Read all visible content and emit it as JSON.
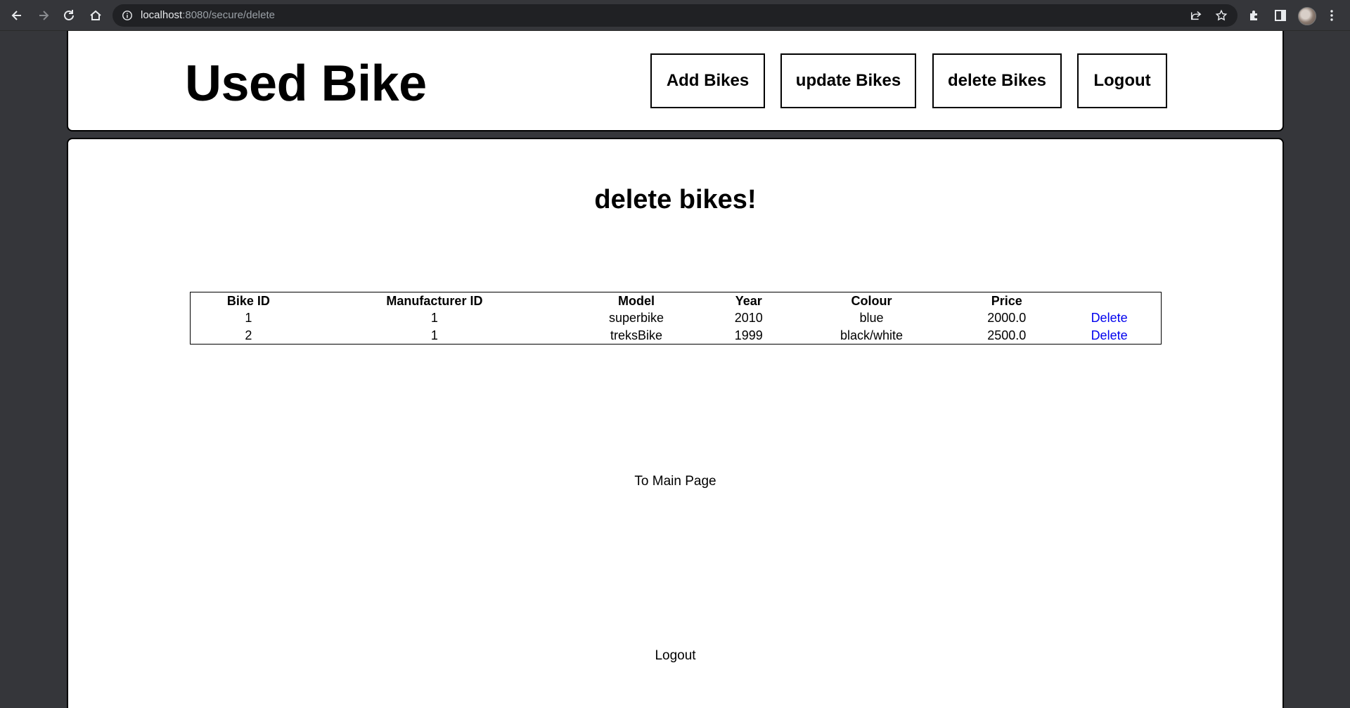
{
  "browser": {
    "url_host": "localhost",
    "url_rest": ":8080/secure/delete"
  },
  "header": {
    "title": "Used Bike",
    "nav": {
      "add_label": "Add Bikes",
      "update_label": "update Bikes",
      "delete_label": "delete Bikes",
      "logout_label": "Logout"
    }
  },
  "main": {
    "heading": "delete bikes!",
    "table": {
      "headers": [
        "Bike ID",
        "Manufacturer ID",
        "Model",
        "Year",
        "Colour",
        "Price",
        ""
      ],
      "rows": [
        {
          "bike_id": "1",
          "manufacturer_id": "1",
          "model": "superbike",
          "year": "2010",
          "colour": "blue",
          "price": "2000.0",
          "action": "Delete"
        },
        {
          "bike_id": "2",
          "manufacturer_id": "1",
          "model": "treksBike",
          "year": "1999",
          "colour": "black/white",
          "price": "2500.0",
          "action": "Delete"
        }
      ]
    },
    "to_main_label": "To Main Page",
    "logout_label": "Logout"
  },
  "colors": {
    "chrome_bg": "#35363a",
    "omnibox_bg": "#202124",
    "link": "#0000ee"
  },
  "icons": [
    "back-arrow-icon",
    "forward-arrow-icon",
    "reload-icon",
    "home-icon",
    "info-icon",
    "share-icon",
    "star-icon",
    "extensions-icon",
    "side-panel-icon",
    "kebab-menu-icon"
  ]
}
